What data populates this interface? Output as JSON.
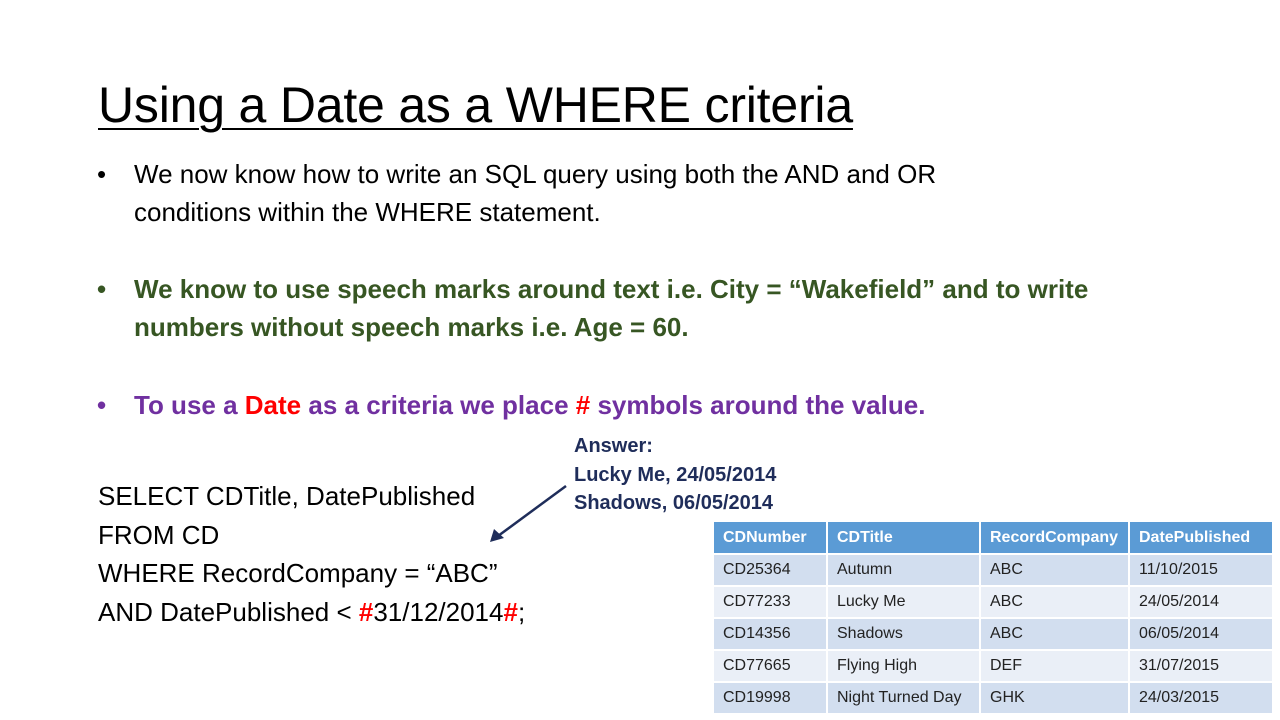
{
  "slide": {
    "title": "Using a Date as a WHERE criteria",
    "bullets": {
      "b1_line1": "We now know how to write an SQL query using both the AND and OR",
      "b1_line2": "conditions within the WHERE statement.",
      "b2_line1": "We know to use speech marks around text i.e. City = “Wakefield” and to write",
      "b2_line2": "numbers without speech marks i.e. Age = 60.",
      "b3_a": "To use a ",
      "b3_date": "Date",
      "b3_b": " as a criteria we place ",
      "b3_hash": "#",
      "b3_c": " symbols around the value."
    },
    "bullet_symbol": "•",
    "sql": {
      "line1": "SELECT  CDTitle, DatePublished",
      "line2": "FROM CD",
      "line3": "WHERE RecordCompany = “ABC”",
      "line4_a": "AND DatePublished < ",
      "hash": "#",
      "line4_date": "31/12/2014",
      "line4_end": ";"
    },
    "answer": {
      "label": "Answer:",
      "line1": "Lucky Me, 24/05/2014",
      "line2": "Shadows, 06/05/2014"
    },
    "table": {
      "headers": [
        "CDNumber",
        "CDTitle",
        "RecordCompany",
        "DatePublished"
      ],
      "rows": [
        [
          "CD25364",
          "Autumn",
          "ABC",
          "11/10/2015"
        ],
        [
          "CD77233",
          "Lucky Me",
          "ABC",
          "24/05/2014"
        ],
        [
          "CD14356",
          "Shadows",
          "ABC",
          "06/05/2014"
        ],
        [
          "CD77665",
          "Flying High",
          "DEF",
          "31/07/2015"
        ],
        [
          "CD19998",
          "Night Turned Day",
          "GHK",
          "24/03/2015"
        ]
      ]
    },
    "colors": {
      "green_text": "#375623",
      "purple_text": "#7030a0",
      "red_highlight": "#ff0000",
      "answer_navy": "#1f2d5a",
      "table_header": "#5b9bd5",
      "table_row_odd": "#d2deef",
      "table_row_even": "#eaeff7"
    },
    "icons": {
      "pointer": "arrow-icon"
    }
  }
}
